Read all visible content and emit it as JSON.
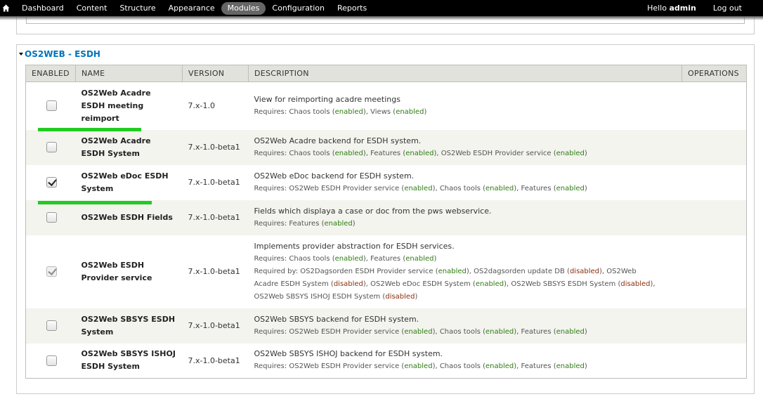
{
  "toolbar": {
    "items": [
      "Dashboard",
      "Content",
      "Structure",
      "Appearance",
      "Modules",
      "Configuration",
      "Reports"
    ],
    "active": "Modules",
    "hello_prefix": "Hello ",
    "username": "admin",
    "logout": "Log out"
  },
  "fieldset": {
    "legend": "OS2WEB - ESDH"
  },
  "table": {
    "headers": {
      "enabled": "ENABLED",
      "name": "NAME",
      "version": "VERSION",
      "description": "DESCRIPTION",
      "operations": "OPERATIONS"
    },
    "rows": [
      {
        "name": "OS2Web Acadre ESDH meeting reimport",
        "version": "7.x-1.0",
        "description": "View for reimporting acadre meetings",
        "requires_label": "Requires: ",
        "requires": [
          [
            "Chaos tools",
            "enabled"
          ],
          [
            "Views",
            "enabled"
          ]
        ],
        "checked": false,
        "disabled": false
      },
      {
        "name": "OS2Web Acadre ESDH System",
        "version": "7.x-1.0-beta1",
        "description": "OS2Web Acadre backend for ESDH system.",
        "requires_label": "Requires: ",
        "requires": [
          [
            "Chaos tools",
            "enabled"
          ],
          [
            "Features",
            "enabled"
          ],
          [
            "OS2Web ESDH Provider service",
            "enabled"
          ]
        ],
        "checked": false,
        "disabled": false
      },
      {
        "name": "OS2Web eDoc ESDH System",
        "version": "7.x-1.0-beta1",
        "description": "OS2Web eDoc backend for ESDH system.",
        "requires_label": "Requires: ",
        "requires": [
          [
            "OS2Web ESDH Provider service",
            "enabled"
          ],
          [
            "Chaos tools",
            "enabled"
          ],
          [
            "Features",
            "enabled"
          ]
        ],
        "checked": true,
        "disabled": false
      },
      {
        "name": "OS2Web ESDH Fields",
        "version": "7.x-1.0-beta1",
        "description": "Fields which displaya a case or doc from the pws webservice.",
        "requires_label": "Requires: ",
        "requires": [
          [
            "Features",
            "enabled"
          ]
        ],
        "checked": false,
        "disabled": false
      },
      {
        "name": "OS2Web ESDH Provider service",
        "version": "7.x-1.0-beta1",
        "description": "Implements provider abstraction for ESDH services.",
        "requires_label": "Requires: ",
        "requires": [
          [
            "Chaos tools",
            "enabled"
          ],
          [
            "Features",
            "enabled"
          ]
        ],
        "required_by_label": "Required by: ",
        "required_by": [
          [
            "OS2Dagsorden ESDH Provider service",
            "enabled"
          ],
          [
            "OS2dagsorden update DB",
            "disabled"
          ],
          [
            "OS2Web Acadre ESDH System",
            "disabled"
          ],
          [
            "OS2Web eDoc ESDH System",
            "enabled"
          ],
          [
            "OS2Web SBSYS ESDH System",
            "disabled"
          ],
          [
            "OS2Web SBSYS ISHOJ ESDH System",
            "disabled"
          ]
        ],
        "checked": true,
        "disabled": true
      },
      {
        "name": "OS2Web SBSYS ESDH System",
        "version": "7.x-1.0-beta1",
        "description": "OS2Web SBSYS backend for ESDH system.",
        "requires_label": "Requires: ",
        "requires": [
          [
            "OS2Web ESDH Provider service",
            "enabled"
          ],
          [
            "Chaos tools",
            "enabled"
          ],
          [
            "Features",
            "enabled"
          ]
        ],
        "checked": false,
        "disabled": false
      },
      {
        "name": "OS2Web SBSYS ISHOJ ESDH System",
        "version": "7.x-1.0-beta1",
        "description": "OS2Web SBSYS ISHOJ backend for ESDH system.",
        "requires_label": "Requires: ",
        "requires": [
          [
            "OS2Web ESDH Provider service",
            "enabled"
          ],
          [
            "Chaos tools",
            "enabled"
          ],
          [
            "Features",
            "enabled"
          ]
        ],
        "checked": false,
        "disabled": false
      }
    ]
  },
  "colors": {
    "highlight": "#22cc22",
    "link": "#0074bd",
    "enabled": "#2f7d14",
    "disabled": "#8c2e0b"
  }
}
